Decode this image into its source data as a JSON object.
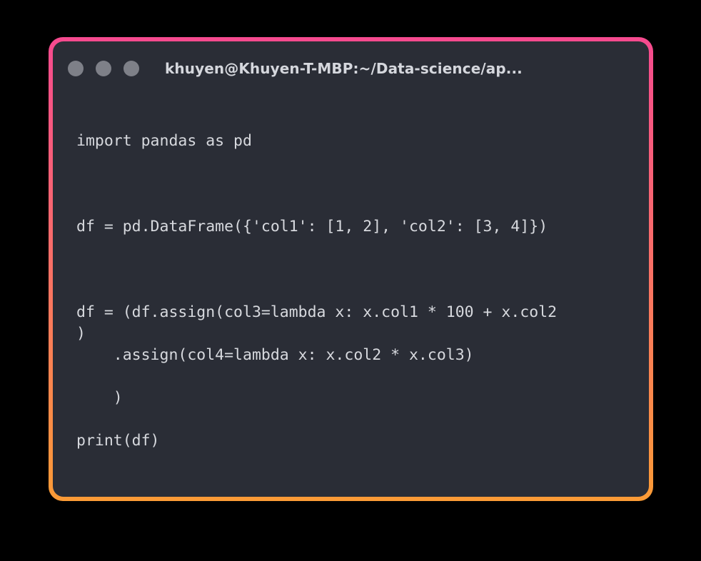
{
  "window": {
    "title": "khuyen@Khuyen-T-MBP:~/Data-science/ap..."
  },
  "code_lines": [
    "import pandas as pd",
    "df = pd.DataFrame({'col1': [1, 2], 'col2': [3, 4]})",
    "df = (df.assign(col3=lambda x: x.col1 * 100 + x.col2",
    ")",
    "    .assign(col4=lambda x: x.col2 * x.col3)",
    "    )",
    "print(df)"
  ],
  "colors": {
    "frame_top": "#f64a8f",
    "frame_bottom": "#fb9b36",
    "window_bg": "#2a2d36",
    "text": "#d7d9de",
    "dot": "#7e8088"
  }
}
